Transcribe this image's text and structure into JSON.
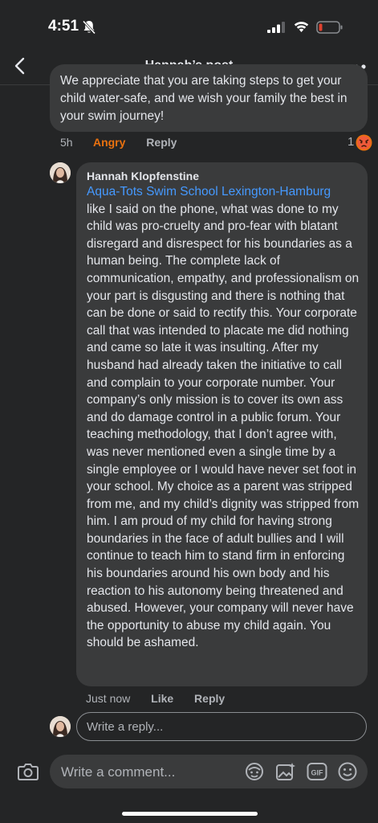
{
  "status_bar": {
    "time": "4:51"
  },
  "header": {
    "title": "Hannah’s post"
  },
  "previous_comment": {
    "text": "We appreciate that you are taking steps to get your child water-safe, and we wish your family the best in your swim journey!",
    "time_ago": "5h",
    "reaction_label": "Angry",
    "reply_label": "Reply",
    "reaction_count": "1"
  },
  "reply": {
    "author": "Hannah Klopfenstine",
    "mention": "Aqua-Tots Swim School Lexington-Hamburg",
    "text": "like I said on the phone, what was done to my child was pro-cruelty and pro-fear with blatant disregard and disrespect for his boundaries as a human being. The complete lack of communication, empathy, and professionalism on your part is disgusting and there is nothing that can be done or said to rectify this. Your corporate call that was intended to placate me did nothing and came so late it was insulting. After my husband had already taken the initiative to call and complain to your corporate number. Your company’s only mission is to cover its own ass and do damage control in a public forum. Your teaching methodology, that I don’t agree with, was never mentioned even a single time by a single employee or I would have never set foot in your school. My choice as a parent was stripped from me, and my child’s dignity was stripped from him. I am proud of my child for having strong boundaries in the face of adult bullies and I will continue to teach him to stand firm in enforcing his boundaries around his own body and his reaction to his autonomy being threatened and abused. However, your company will never have the opportunity to abuse my child again. You should be ashamed.",
    "time_ago": "Just now",
    "like_label": "Like",
    "reply_label": "Reply"
  },
  "write_reply": {
    "placeholder": "Write a reply..."
  },
  "comment_bar": {
    "placeholder": "Write a comment..."
  },
  "icons": {
    "back": "chevron-left-icon",
    "more": "more-horizontal-icon",
    "camera": "camera-icon",
    "avatar_frame": "avatar-frame-icon",
    "photo": "photo-sparkle-icon",
    "gif": "gif-icon",
    "emoji": "emoji-icon",
    "angry": "angry-face-icon"
  },
  "colors": {
    "background": "#242526",
    "bubble": "#3a3b3c",
    "link": "#4599ff",
    "angry": "#e9710f",
    "battery_low": "#e0412f"
  }
}
